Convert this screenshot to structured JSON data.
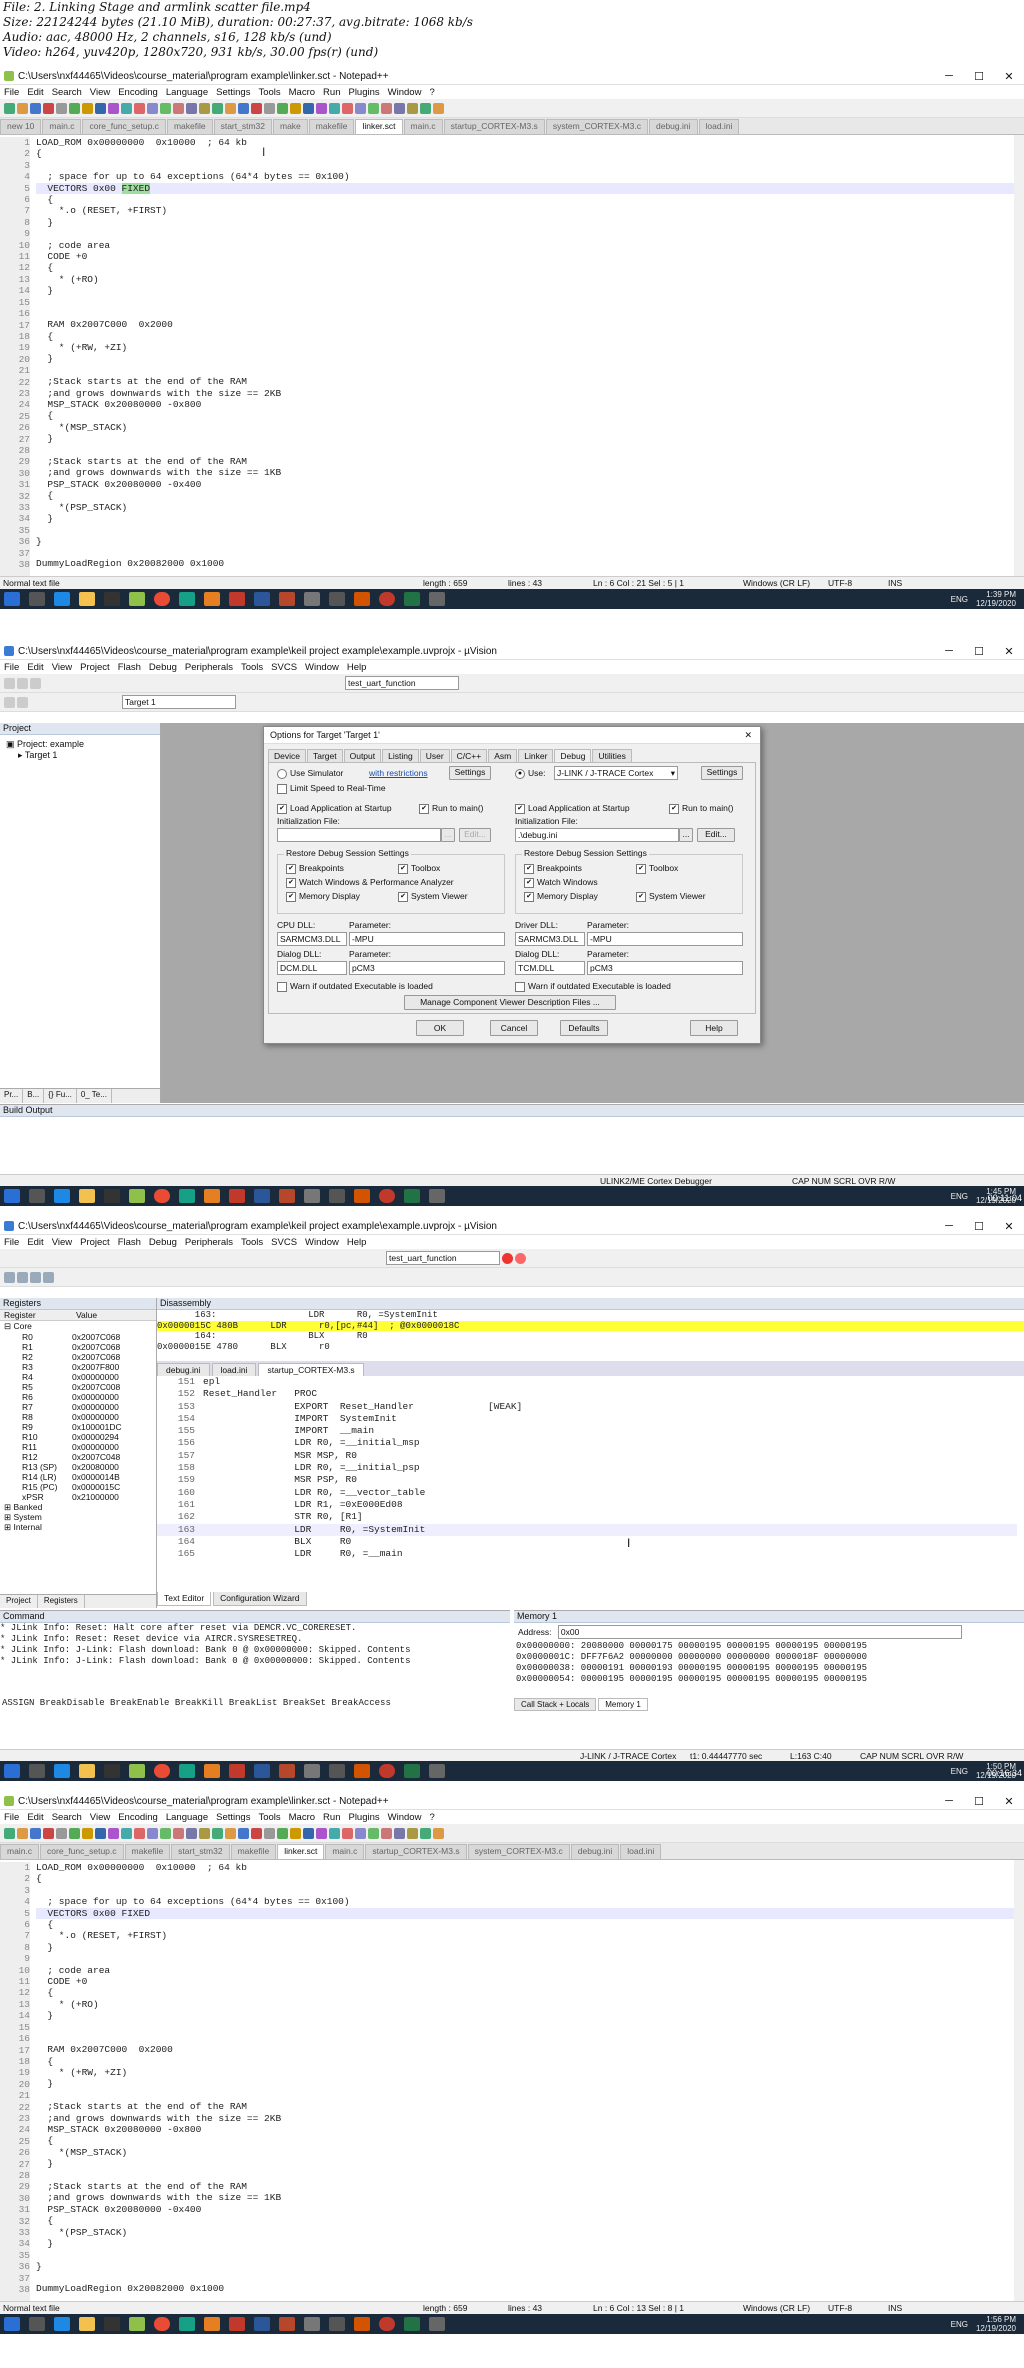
{
  "media_info": {
    "file": "File: 2. Linking Stage and armlink scatter file.mp4",
    "size": "Size: 22124244 bytes (21.10 MiB), duration: 00:27:37, avg.bitrate: 1068 kb/s",
    "audio": "Audio: aac, 48000 Hz, 2 channels, s16, 128 kb/s (und)",
    "video": "Video: h264, yuv420p, 1280x720, 931 kb/s, 30.00 fps(r) (und)"
  },
  "np1": {
    "title": "C:\\Users\\nxf44465\\Videos\\course_material\\program example\\linker.sct - Notepad++",
    "menu": [
      "File",
      "Edit",
      "Search",
      "View",
      "Encoding",
      "Language",
      "Settings",
      "Tools",
      "Macro",
      "Run",
      "Plugins",
      "Window",
      "?"
    ],
    "tabs": [
      "new 10",
      "main.c",
      "core_func_setup.c",
      "makefile",
      "start_stm32",
      "make",
      "makefile",
      "linker.sct",
      "main.c",
      "startup_CORTEX-M3.s",
      "system_CORTEX-M3.c",
      "debug.ini",
      "load.ini"
    ],
    "active_tab": 7,
    "lines": [
      "LOAD_ROM 0x00000000  0x10000  ; 64 kb",
      "{",
      "",
      "  ; space for up to 64 exceptions (64*4 bytes == 0x100)",
      "  VECTORS 0x00 FIXED",
      "  {",
      "    *.o (RESET, +FIRST)",
      "  }",
      "",
      "  ; code area",
      "  CODE +0",
      "  {",
      "    * (+RO)",
      "  }",
      "",
      "",
      "  RAM 0x2007C000  0x2000",
      "  {",
      "    * (+RW, +ZI)",
      "  }",
      "",
      "  ;Stack starts at the end of the RAM",
      "  ;and grows downwards with the size == 2KB",
      "  MSP_STACK 0x20080000 -0x800",
      "  {",
      "    *(MSP_STACK)",
      "  }",
      "",
      "  ;Stack starts at the end of the RAM",
      "  ;and grows downwards with the size == 1KB",
      "  PSP_STACK 0x20080000 -0x400",
      "  {",
      "    *(PSP_STACK)",
      "  }",
      "",
      "}",
      "",
      "DummyLoadRegion 0x20082000 0x1000"
    ],
    "status": {
      "type": "Normal text file",
      "length": "length : 659",
      "lines": "lines : 43",
      "pos": "Ln : 6    Col : 21    Sel : 5 | 1",
      "eol": "Windows (CR LF)",
      "enc": "UTF-8",
      "ins": "INS"
    },
    "clock": {
      "time": "1:39 PM",
      "date": "12/19/2020"
    },
    "video_ts": "00:05:32"
  },
  "uv1": {
    "title": "C:\\Users\\nxf44465\\Videos\\course_material\\program example\\keil project example\\example.uvprojx - µVision",
    "menu": [
      "File",
      "Edit",
      "View",
      "Project",
      "Flash",
      "Debug",
      "Peripherals",
      "Tools",
      "SVCS",
      "Window",
      "Help"
    ],
    "target_combo": "test_uart_function",
    "target_select": "Target 1",
    "project_panel_title": "Project",
    "project_root": "Project: example",
    "project_target": "Target 1",
    "bottom_tabs": [
      "Pr...",
      "B...",
      "{} Fu...",
      "0_ Te..."
    ],
    "build_output_title": "Build Output",
    "status_right": "ULINK2/ME Cortex Debugger",
    "status_flags": "CAP  NUM  SCRL  OVR  R/W",
    "clock": {
      "time": "1:45 PM",
      "date": "12/19/2020"
    },
    "video_ts": "00:11:04",
    "dialog": {
      "title": "Options for Target 'Target 1'",
      "tabs": [
        "Device",
        "Target",
        "Output",
        "Listing",
        "User",
        "C/C++",
        "Asm",
        "Linker",
        "Debug",
        "Utilities"
      ],
      "active_tab": "Debug",
      "left": {
        "use_sim": "Use Simulator",
        "with_restrictions": "with restrictions",
        "settings": "Settings",
        "limit_speed": "Limit Speed to Real-Time",
        "load_app": "Load Application at Startup",
        "run_to_main": "Run to main()",
        "init_file_label": "Initialization File:",
        "init_file": "",
        "edit": "Edit...",
        "restore_title": "Restore Debug Session Settings",
        "breakpoints": "Breakpoints",
        "toolbox": "Toolbox",
        "watch": "Watch Windows & Performance Analyzer",
        "memory": "Memory Display",
        "sysviewer": "System Viewer",
        "cpu_dll_label": "CPU DLL:",
        "param_label": "Parameter:",
        "cpu_dll": "SARMCM3.DLL",
        "cpu_param": "-MPU",
        "dialog_dll_label": "Dialog DLL:",
        "dialog_dll": "DCM.DLL",
        "dialog_param": "pCM3",
        "warn": "Warn if outdated Executable is loaded"
      },
      "right": {
        "use": "Use:",
        "debugger": "J-LINK / J-TRACE Cortex",
        "settings": "Settings",
        "load_app": "Load Application at Startup",
        "run_to_main": "Run to main()",
        "init_file_label": "Initialization File:",
        "init_file": ".\\debug.ini",
        "browse": "...",
        "edit": "Edit...",
        "restore_title": "Restore Debug Session Settings",
        "breakpoints": "Breakpoints",
        "toolbox": "Toolbox",
        "watch": "Watch Windows",
        "memory": "Memory Display",
        "sysviewer": "System Viewer",
        "driver_dll_label": "Driver DLL:",
        "param_label": "Parameter:",
        "driver_dll": "SARMCM3.DLL",
        "driver_param": "-MPU",
        "dialog_dll_label": "Dialog DLL:",
        "dialog_dll": "TCM.DLL",
        "dialog_param": "pCM3",
        "warn": "Warn if outdated Executable is loaded"
      },
      "manage": "Manage Component Viewer Description Files ...",
      "ok": "OK",
      "cancel": "Cancel",
      "defaults": "Defaults",
      "help": "Help"
    }
  },
  "uv2": {
    "title": "C:\\Users\\nxf44465\\Videos\\course_material\\program example\\keil project example\\example.uvprojx - µVision",
    "menu": [
      "File",
      "Edit",
      "View",
      "Project",
      "Flash",
      "Debug",
      "Peripherals",
      "Tools",
      "SVCS",
      "Window",
      "Help"
    ],
    "target_combo": "test_uart_function",
    "registers_title": "Registers",
    "reg_headers": [
      "Register",
      "Value"
    ],
    "reg_group": "Core",
    "registers": [
      [
        "R0",
        "0x2007C068"
      ],
      [
        "R1",
        "0x2007C068"
      ],
      [
        "R2",
        "0x2007C068"
      ],
      [
        "R3",
        "0x2007F800"
      ],
      [
        "R4",
        "0x00000000"
      ],
      [
        "R5",
        "0x2007C008"
      ],
      [
        "R6",
        "0x00000000"
      ],
      [
        "R7",
        "0x00000000"
      ],
      [
        "R8",
        "0x00000000"
      ],
      [
        "R9",
        "0x100001DC"
      ],
      [
        "R10",
        "0x00000294"
      ],
      [
        "R11",
        "0x00000000"
      ],
      [
        "R12",
        "0x2007C048"
      ],
      [
        "R13 (SP)",
        "0x20080000"
      ],
      [
        "R14 (LR)",
        "0x0000014B"
      ],
      [
        "R15 (PC)",
        "0x0000015C"
      ],
      [
        "xPSR",
        "0x21000000"
      ]
    ],
    "reg_extra": [
      "Banked",
      "System",
      "Internal"
    ],
    "reg_tabs": [
      "Project",
      "Registers"
    ],
    "disasm_title": "Disassembly",
    "disasm": [
      "       163:                 LDR      R0, =SystemInit",
      "0x0000015C 480B      LDR      r0,[pc,#44]  ; @0x0000018C",
      "       164:                 BLX      R0",
      "0x0000015E 4780      BLX      r0"
    ],
    "editor_tabs": [
      "debug.ini",
      "load.ini",
      "startup_CORTEX-M3.s"
    ],
    "editor_lines": [
      [
        "151",
        "epl"
      ],
      [
        "152",
        "Reset_Handler   PROC"
      ],
      [
        "153",
        "                EXPORT  Reset_Handler             [WEAK]"
      ],
      [
        "154",
        "                IMPORT  SystemInit"
      ],
      [
        "155",
        "                IMPORT  __main"
      ],
      [
        "156",
        "                LDR R0, =__initial_msp"
      ],
      [
        "157",
        "                MSR MSP, R0"
      ],
      [
        "158",
        "                LDR R0, =__initial_psp"
      ],
      [
        "159",
        "                MSR PSP, R0"
      ],
      [
        "160",
        "                LDR R0, =__vector_table"
      ],
      [
        "161",
        "                LDR R1, =0xE000Ed08"
      ],
      [
        "162",
        "                STR R0, [R1]"
      ],
      [
        "163",
        "                LDR     R0, =SystemInit"
      ],
      [
        "164",
        "                BLX     R0"
      ],
      [
        "165",
        "                LDR     R0, =__main"
      ]
    ],
    "editor_bottom_tabs": [
      "Text Editor",
      "Configuration Wizard"
    ],
    "command_title": "Command",
    "command_lines": [
      "* JLink Info: Reset: Halt core after reset via DEMCR.VC_CORERESET.",
      "* JLink Info: Reset: Reset device via AIRCR.SYSRESETREQ.",
      "* JLink Info: J-Link: Flash download: Bank 0 @ 0x00000000: Skipped. Contents",
      "* JLink Info: J-Link: Flash download: Bank 0 @ 0x00000000: Skipped. Contents"
    ],
    "command_input": "ASSIGN BreakDisable BreakEnable BreakKill BreakList BreakSet BreakAccess",
    "memory_title": "Memory 1",
    "memory_address_label": "Address:",
    "memory_address": "0x00",
    "memory_lines": [
      "0x00000000: 20080000 00000175 00000195 00000195 00000195 00000195",
      "0x0000001C: DFF7F6A2 00000000 00000000 00000000 0000018F 00000000",
      "0x00000038: 00000191 00000193 00000195 00000195 00000195 00000195",
      "0x00000054: 00000195 00000195 00000195 00000195 00000195 00000195"
    ],
    "memory_tabs": [
      "Call Stack + Locals",
      "Memory 1"
    ],
    "status_left": "J-LINK / J-TRACE Cortex",
    "status_time": "t1: 0.44447770 sec",
    "status_pos": "L:163 C:40",
    "status_flags": "CAP  NUM  SCRL  OVR  R/W",
    "clock": {
      "time": "1:50 PM",
      "date": "12/19/2020"
    },
    "video_ts": "00:16:34"
  },
  "np2": {
    "title": "C:\\Users\\nxf44465\\Videos\\course_material\\program example\\linker.sct - Notepad++",
    "menu": [
      "File",
      "Edit",
      "Search",
      "View",
      "Encoding",
      "Language",
      "Settings",
      "Tools",
      "Macro",
      "Run",
      "Plugins",
      "Window",
      "?"
    ],
    "tabs": [
      "main.c",
      "core_func_setup.c",
      "makefile",
      "start_stm32",
      "makefile",
      "linker.sct",
      "main.c",
      "startup_CORTEX-M3.s",
      "system_CORTEX-M3.c",
      "debug.ini",
      "load.ini"
    ],
    "active_tab": 5,
    "status": {
      "type": "Normal text file",
      "length": "length : 659",
      "lines": "lines : 43",
      "pos": "Ln : 6    Col : 13    Sel : 8 | 1",
      "eol": "Windows (CR LF)",
      "enc": "UTF-8",
      "ins": "INS"
    },
    "clock": {
      "time": "1:56 PM",
      "date": "12/19/2020"
    },
    "video_ts": "00:22:04"
  },
  "tray": {
    "lang": "ENG"
  },
  "colors": {
    "highlight_line": "#e8e8ff",
    "debug_line": "#ffff33",
    "fixed_highlight": "#9fdc9f",
    "taskbar": "#1a2a3a",
    "keyword": "#0000ff"
  }
}
